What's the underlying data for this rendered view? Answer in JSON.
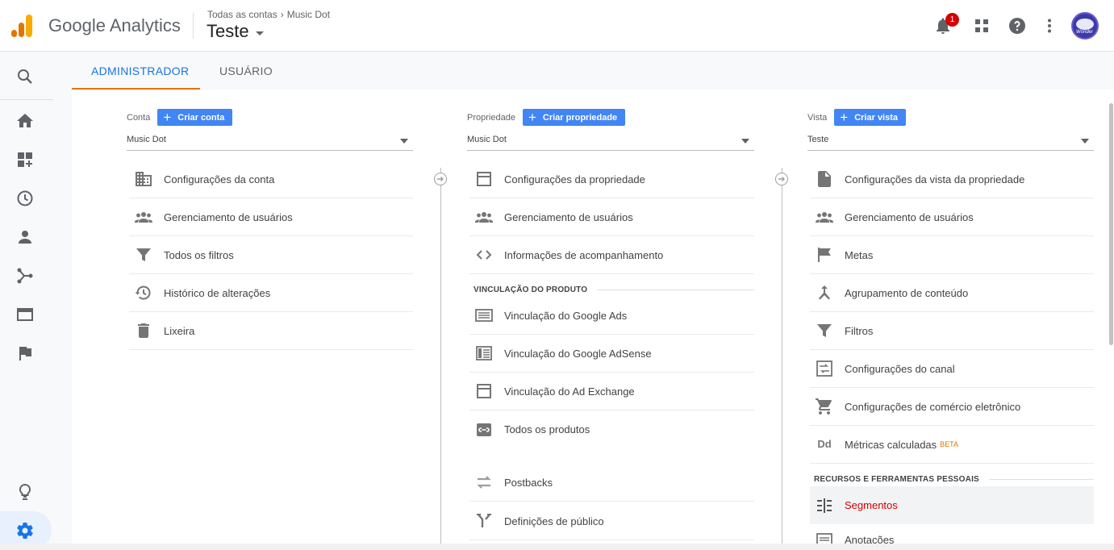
{
  "header": {
    "brand": "Google Analytics",
    "breadcrumb": [
      "Todas as contas",
      "Music Dot"
    ],
    "view_name": "Teste",
    "notification_count": "1",
    "avatar_text": "Wonder"
  },
  "tabs": [
    {
      "label": "ADMINISTRADOR",
      "active": true
    },
    {
      "label": "USUÁRIO",
      "active": false
    }
  ],
  "columns": {
    "account": {
      "label": "Conta",
      "create_label": "Criar conta",
      "selected": "Music Dot",
      "items": [
        {
          "label": "Configurações da conta",
          "icon": "building-icon"
        },
        {
          "label": "Gerenciamento de usuários",
          "icon": "people-icon"
        },
        {
          "label": "Todos os filtros",
          "icon": "filter-icon"
        },
        {
          "label": "Histórico de alterações",
          "icon": "history-icon"
        },
        {
          "label": "Lixeira",
          "icon": "trash-icon"
        }
      ]
    },
    "property": {
      "label": "Propriedade",
      "create_label": "Criar propriedade",
      "selected": "Music Dot",
      "items": [
        {
          "label": "Configurações da propriedade",
          "icon": "square-icon"
        },
        {
          "label": "Gerenciamento de usuários",
          "icon": "people-icon"
        },
        {
          "label": "Informações de acompanhamento",
          "icon": "code-icon"
        }
      ],
      "section_title": "VINCULAÇÃO DO PRODUTO",
      "linked_items": [
        {
          "label": "Vinculação do Google Ads",
          "icon": "ads-icon"
        },
        {
          "label": "Vinculação do Google AdSense",
          "icon": "adsense-icon"
        },
        {
          "label": "Vinculação do Ad Exchange",
          "icon": "adx-icon"
        },
        {
          "label": "Todos os produtos",
          "icon": "link-icon"
        },
        {
          "label": "Postbacks",
          "icon": "swap-icon"
        },
        {
          "label": "Definições de público",
          "icon": "fork-icon"
        }
      ]
    },
    "view": {
      "label": "Vista",
      "create_label": "Criar vista",
      "selected": "Teste",
      "items": [
        {
          "label": "Configurações da vista da propriedade",
          "icon": "document-icon"
        },
        {
          "label": "Gerenciamento de usuários",
          "icon": "people-icon"
        },
        {
          "label": "Metas",
          "icon": "flag-icon"
        },
        {
          "label": "Agrupamento de conteúdo",
          "icon": "merge-icon"
        },
        {
          "label": "Filtros",
          "icon": "filter-icon"
        },
        {
          "label": "Configurações do canal",
          "icon": "channel-icon"
        },
        {
          "label": "Configurações de comércio eletrônico",
          "icon": "cart-icon"
        },
        {
          "label": "Métricas calculadas",
          "icon": "dd-icon",
          "badge": "BETA"
        }
      ],
      "section_title": "RECURSOS E FERRAMENTAS PESSOAIS",
      "personal_items": [
        {
          "label": "Segmentos",
          "icon": "segments-icon",
          "selected": true
        },
        {
          "label": "Anotações",
          "icon": "notes-icon"
        }
      ]
    }
  },
  "colors": {
    "accent_blue": "#1a73e8",
    "button_blue": "#4285f4",
    "tab_underline": "#e37400",
    "selected_red": "#d50000",
    "logo_orange": "#e37400",
    "logo_yellow": "#f9ab00"
  }
}
